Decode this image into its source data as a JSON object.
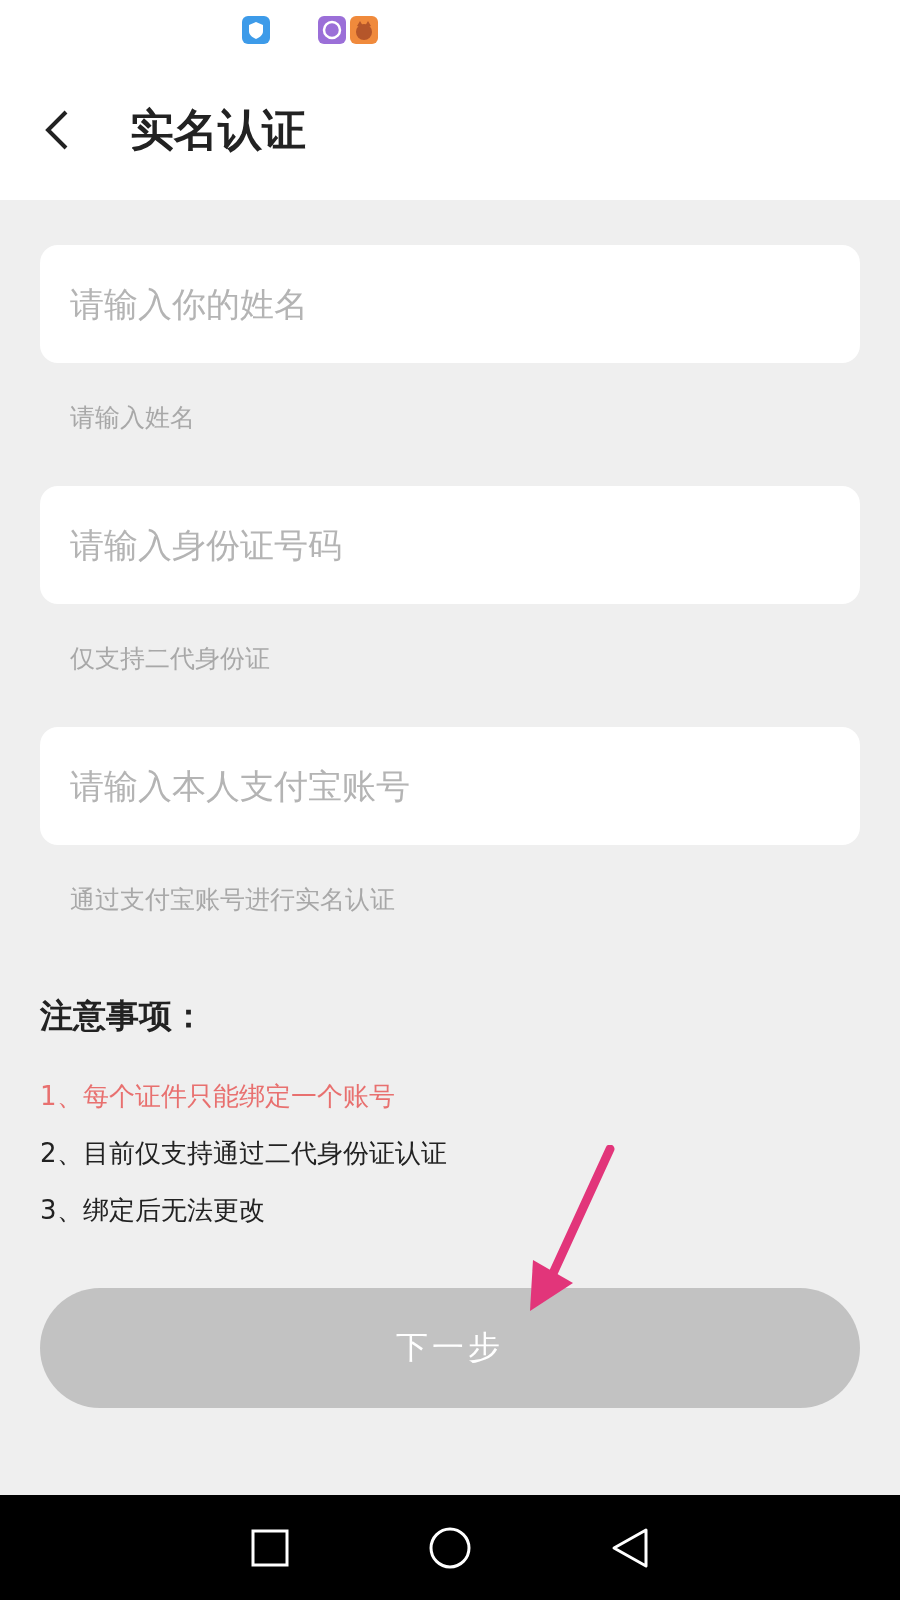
{
  "header": {
    "title": "实名认证"
  },
  "fields": [
    {
      "placeholder": "请输入你的姓名",
      "hint": "请输入姓名"
    },
    {
      "placeholder": "请输入身份证号码",
      "hint": "仅支持二代身份证"
    },
    {
      "placeholder": "请输入本人支付宝账号",
      "hint": "通过支付宝账号进行实名认证"
    }
  ],
  "notice": {
    "title": "注意事项：",
    "items": [
      {
        "text": "1、每个证件只能绑定一个账号",
        "color": "#e8706f"
      },
      {
        "text": "2、目前仅支持通过二代身份证认证",
        "color": "#222222"
      },
      {
        "text": "3、绑定后无法更改",
        "color": "#222222"
      }
    ]
  },
  "next_button": {
    "label": "下一步",
    "disabled": true
  }
}
